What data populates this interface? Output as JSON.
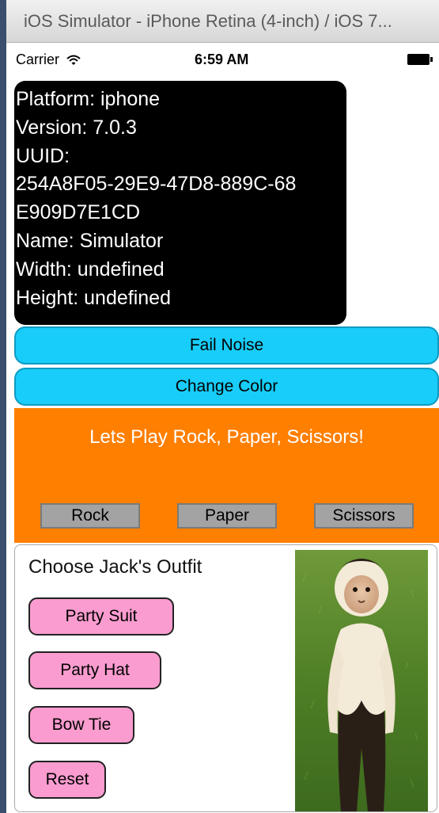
{
  "window": {
    "title": "iOS Simulator - iPhone Retina (4-inch) / iOS 7..."
  },
  "statusbar": {
    "carrier": "Carrier",
    "time": "6:59 AM",
    "wifi_icon": "wifi-icon",
    "battery_icon": "battery-icon"
  },
  "device_info": {
    "lines": [
      "Platform: iphone",
      "Version: 7.0.3",
      "UUID:",
      "254A8F05-29E9-47D8-889C-68",
      "E909D7E1CD",
      "Name: Simulator",
      "Width: undefined",
      "Height: undefined"
    ]
  },
  "buttons": {
    "fail_noise": "Fail Noise",
    "change_color": "Change Color"
  },
  "rps": {
    "title": "Lets Play Rock, Paper, Scissors!",
    "rock": "Rock",
    "paper": "Paper",
    "scissors": "Scissors"
  },
  "outfit": {
    "title": "Choose Jack's Outfit",
    "party_suit": "Party Suit",
    "party_hat": "Party Hat",
    "bow_tie": "Bow Tie",
    "reset": "Reset"
  },
  "colors": {
    "info_bg": "#000000",
    "blue_button": "#18cdfa",
    "orange_panel": "#ff7f00",
    "pink_button": "#fa9ccf",
    "gray_button": "#a3a3a3"
  }
}
